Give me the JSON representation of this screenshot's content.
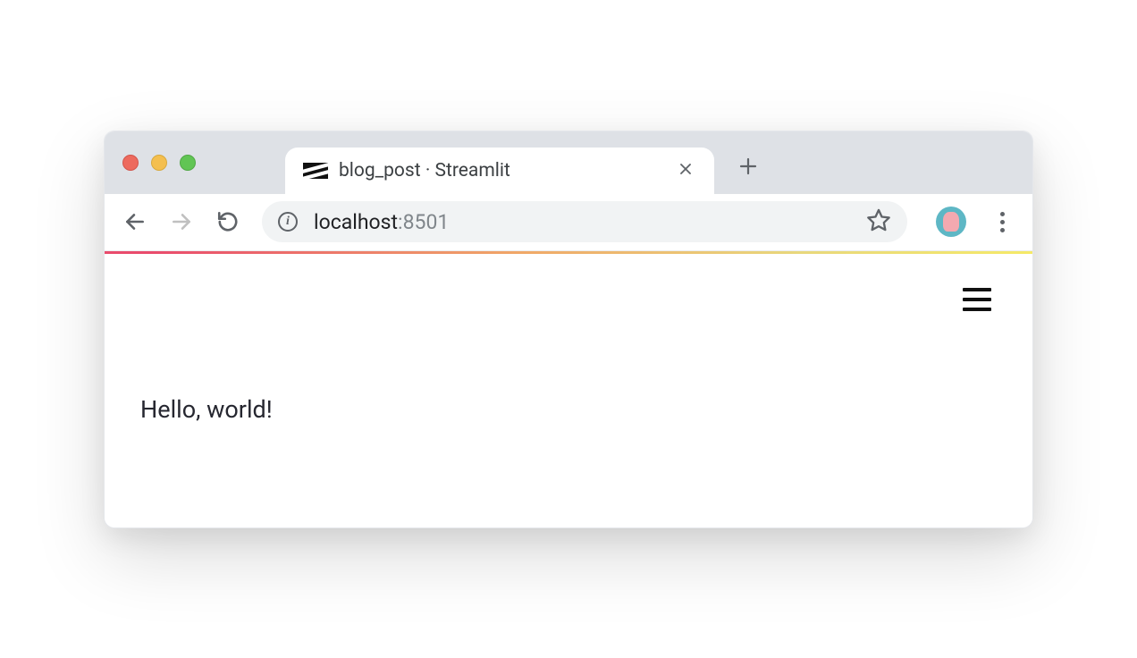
{
  "browser": {
    "tab": {
      "title": "blog_post · Streamlit",
      "favicon": "streamlit-icon"
    },
    "address": {
      "host": "localhost",
      "port": ":8501"
    }
  },
  "app": {
    "content_text": "Hello, world!"
  }
}
